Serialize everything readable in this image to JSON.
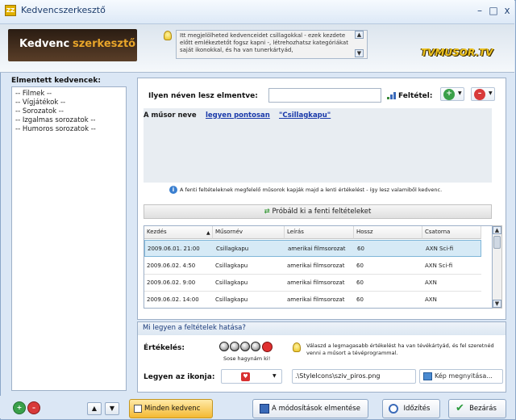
{
  "window": {
    "title": "Kedvencszerkesztő",
    "minimize": "–",
    "maximize": "□",
    "close": "x"
  },
  "header": {
    "logo_part1": "Kedvenc",
    "logo_part2": "szerkesztő",
    "info_text": "Itt megjelölheted kedvenceidet csillagokkal - ezek kezdete előtt emlékeztetőt fogsz kapni -, létrehozhatsz kategóriákat saját ikonokkal, és ha van tunerkártyád,",
    "brand": "TVMUSOR.TV"
  },
  "sidebar": {
    "label": "Elmentett kedvencek:",
    "items": [
      "-- Filmek --",
      "-- Vígjátékok --",
      "-- Sorozatok --",
      "-- Izgalmas sorozatok --",
      "-- Humoros sorozatok --"
    ]
  },
  "form": {
    "save_label": "Ilyen néven lesz elmentve:",
    "save_value": "",
    "condition_label": "Feltétel:"
  },
  "condition": {
    "prefix": "A műsor neve",
    "match": "legyen pontosan",
    "value": "\"Csillagkapu\""
  },
  "note": "A fenti feltételeknek megfelelő műsorok kapják majd a lenti értékelést - így lesz valamiből kedvenc.",
  "try_button": "Próbáld ki a fenti feltételeket",
  "table": {
    "columns": [
      "Kezdés",
      "Műsornév",
      "Leírás",
      "Hossz",
      "Csatorna"
    ],
    "rows": [
      [
        "2009.06.01. 21:00",
        "Csillagkapu",
        "amerikai filmsorozat",
        "60",
        "AXN Sci-fi"
      ],
      [
        "2009.06.02. 4:50",
        "Csillagkapu",
        "amerikai filmsorozat",
        "60",
        "AXN Sci-fi"
      ],
      [
        "2009.06.02. 9:00",
        "Csillagkapu",
        "amerikai filmsorozat",
        "60",
        "AXN"
      ],
      [
        "2009.06.02. 14:00",
        "Csillagkapu",
        "amerikai filmsorozat",
        "60",
        "AXN"
      ]
    ]
  },
  "effect": {
    "header": "Mi legyen a feltételek hatása?",
    "rating_label": "Értékelés:",
    "rating_caption": "Sose hagynám ki!",
    "rating_hint": "Válaszd a legmagasabb értékelést ha van tévékártyád, és fel szeretnéd venni a műsort a tévéprogrammal.",
    "icon_label": "Legyen az ikonja:",
    "icon_path": ".\\StyleIcons\\sziv_piros.png",
    "open_image": "Kép megnyitása..."
  },
  "footer": {
    "all_favorites": "Minden kedvenc",
    "save_changes": "A módosítások elmentése",
    "timing": "Időzítés",
    "close": "Bezárás"
  },
  "colors": {
    "brand_gold": "#f0c520",
    "accent": "#e8a52a",
    "selection": "#d6eaf6"
  }
}
